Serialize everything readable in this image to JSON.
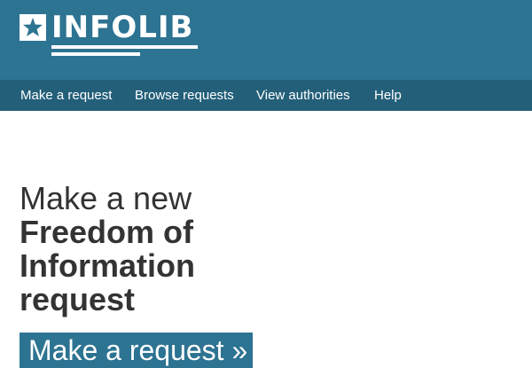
{
  "brand": {
    "name": "INFOLIB",
    "logo_icon": "star-icon",
    "header_color": "#2d7392",
    "nav_color": "#235f79"
  },
  "nav": {
    "items": [
      {
        "label": "Make a request"
      },
      {
        "label": "Browse requests"
      },
      {
        "label": "View authorities"
      },
      {
        "label": "Help"
      }
    ]
  },
  "hero": {
    "line1": "Make a new",
    "line2": "Freedom of",
    "line3": "Information",
    "line4": "request"
  },
  "cta": {
    "label": "Make a request »"
  }
}
